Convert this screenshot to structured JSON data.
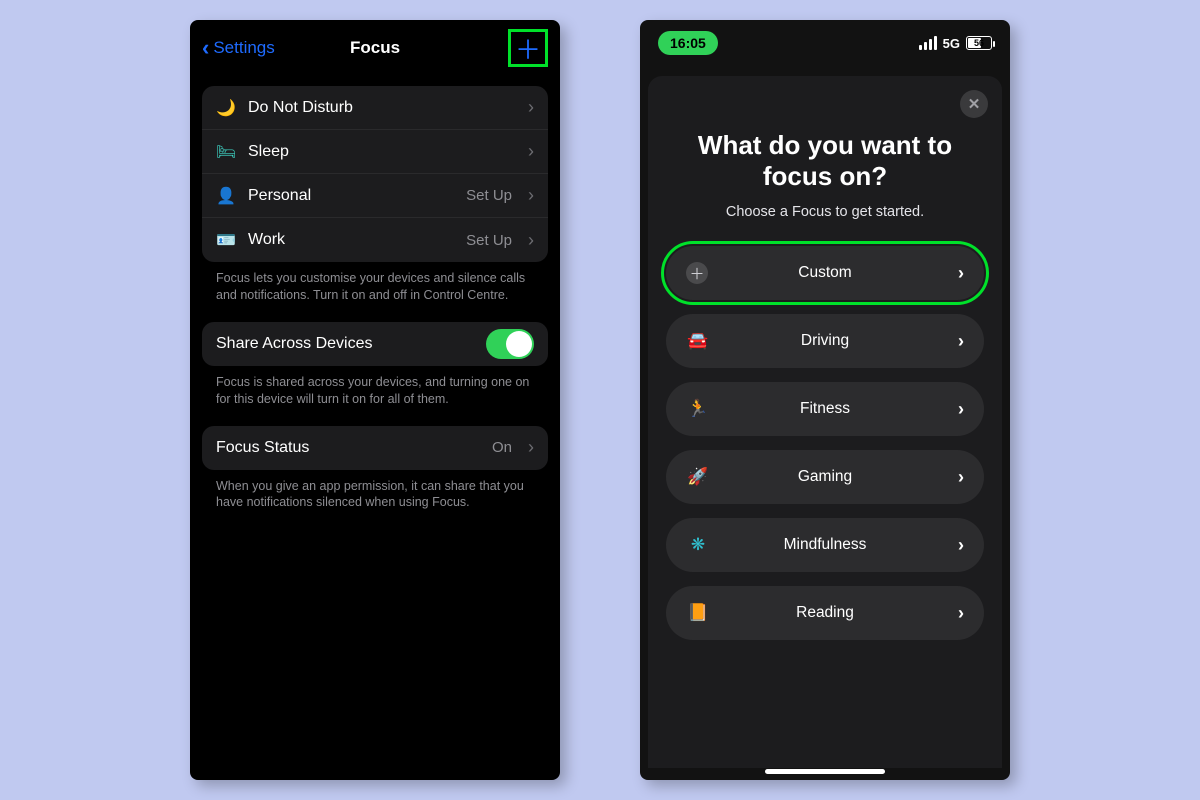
{
  "left": {
    "back_label": "Settings",
    "title": "Focus",
    "modes": [
      {
        "icon": "🌙",
        "icon_color": "#6a68d6",
        "name": "Do Not Disturb",
        "detail": ""
      },
      {
        "icon": "🛏",
        "icon_color": "#3fd6c7",
        "name": "Sleep",
        "detail": ""
      },
      {
        "icon": "👤",
        "icon_color": "#b84bd8",
        "name": "Personal",
        "detail": "Set Up"
      },
      {
        "icon": "🪪",
        "icon_color": "#5a7aff",
        "name": "Work",
        "detail": "Set Up"
      }
    ],
    "modes_footer": "Focus lets you customise your devices and silence calls and notifications. Turn it on and off in Control Centre.",
    "share_label": "Share Across Devices",
    "share_footer": "Focus is shared across your devices, and turning one on for this device will turn it on for all of them.",
    "status_label": "Focus Status",
    "status_value": "On",
    "status_footer": "When you give an app permission, it can share that you have notifications silenced when using Focus."
  },
  "right": {
    "time": "16:05",
    "network": "5G",
    "battery": "56",
    "title": "What do you want to focus on?",
    "subtitle": "Choose a Focus to get started.",
    "options": [
      {
        "id": "custom",
        "label": "Custom",
        "icon": "plus-circle",
        "color": "#cfcfd4",
        "highlighted": true
      },
      {
        "id": "driving",
        "label": "Driving",
        "icon": "🚘",
        "color": "#5a7aff"
      },
      {
        "id": "fitness",
        "label": "Fitness",
        "icon": "🏃",
        "color": "#30d158"
      },
      {
        "id": "gaming",
        "label": "Gaming",
        "icon": "🚀",
        "color": "#2f7bff"
      },
      {
        "id": "mindfulness",
        "label": "Mindfulness",
        "icon": "❋",
        "color": "#30c0d0"
      },
      {
        "id": "reading",
        "label": "Reading",
        "icon": "📙",
        "color": "#ff9f0a"
      }
    ]
  }
}
